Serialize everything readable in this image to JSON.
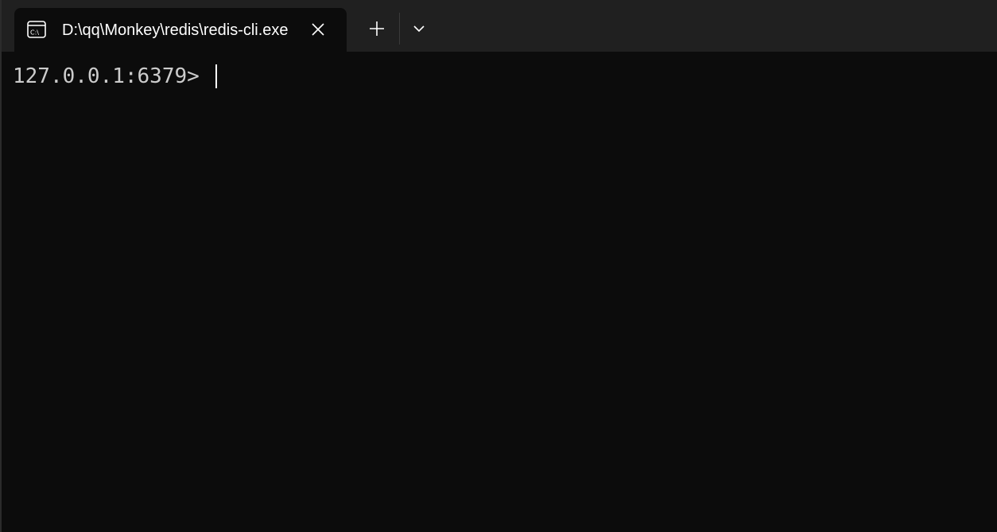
{
  "tab": {
    "title": "D:\\qq\\Monkey\\redis\\redis-cli.exe",
    "icon": "command-prompt-icon",
    "close_icon": "close-icon"
  },
  "toolbar": {
    "new_tab_icon": "plus-icon",
    "dropdown_icon": "chevron-down-icon"
  },
  "terminal": {
    "prompt": "127.0.0.1:6379> ",
    "input": ""
  },
  "colors": {
    "titlebar_bg": "#202020",
    "terminal_bg": "#0c0c0c",
    "text": "#cccccc",
    "tab_title": "#ffffff"
  }
}
